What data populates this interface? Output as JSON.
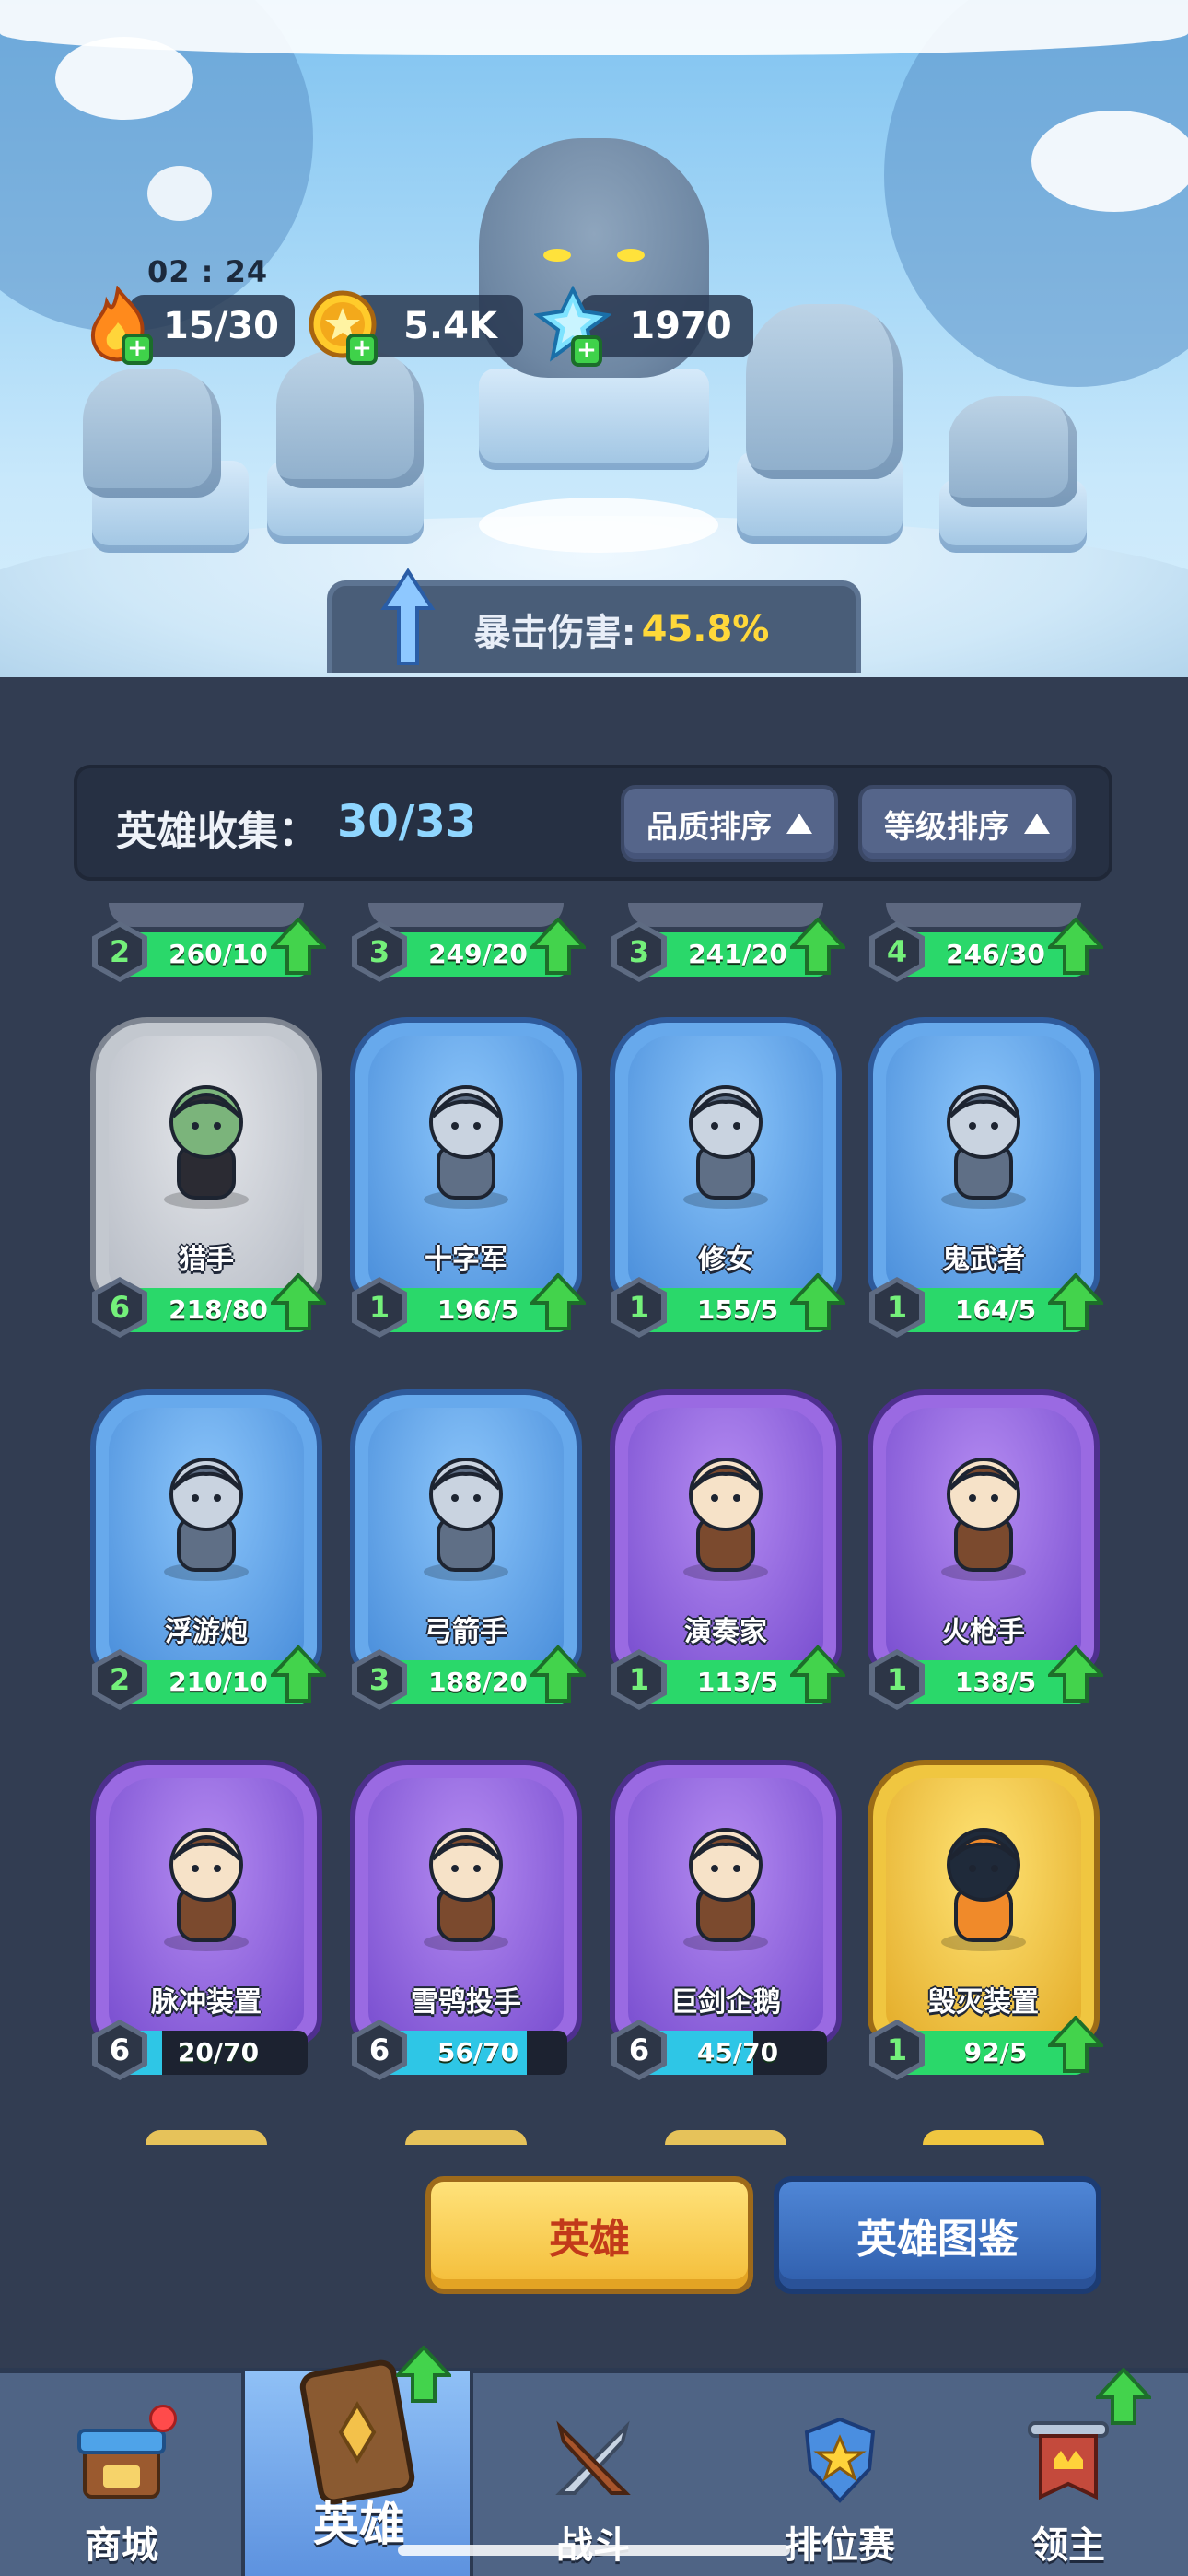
{
  "status": {
    "timer": "02 : 24",
    "energy": "15/30",
    "gold": "5.4K",
    "gems": "1970"
  },
  "crit": {
    "label": "暴击伤害:",
    "value": "45.8%"
  },
  "collection": {
    "title": "英雄收集：",
    "count": "30/33",
    "sort_quality": "品质排序",
    "sort_level": "等级排序"
  },
  "partial_row": [
    {
      "level": "2",
      "progress": "260/10",
      "fill": 1.0
    },
    {
      "level": "3",
      "progress": "249/20",
      "fill": 1.0
    },
    {
      "level": "3",
      "progress": "241/20",
      "fill": 1.0
    },
    {
      "level": "4",
      "progress": "246/30",
      "fill": 1.0
    }
  ],
  "heroes": [
    {
      "name": "猎手",
      "rarity": "grey",
      "level": "6",
      "progress": "218/80",
      "fill": 1.0,
      "upgrade": true
    },
    {
      "name": "十字军",
      "rarity": "blue",
      "level": "1",
      "progress": "196/5",
      "fill": 1.0,
      "upgrade": true
    },
    {
      "name": "修女",
      "rarity": "blue",
      "level": "1",
      "progress": "155/5",
      "fill": 1.0,
      "upgrade": true
    },
    {
      "name": "鬼武者",
      "rarity": "blue",
      "level": "1",
      "progress": "164/5",
      "fill": 1.0,
      "upgrade": true
    },
    {
      "name": "浮游炮",
      "rarity": "blue",
      "level": "2",
      "progress": "210/10",
      "fill": 1.0,
      "upgrade": true
    },
    {
      "name": "弓箭手",
      "rarity": "blue",
      "level": "3",
      "progress": "188/20",
      "fill": 1.0,
      "upgrade": true
    },
    {
      "name": "演奏家",
      "rarity": "purple",
      "level": "1",
      "progress": "113/5",
      "fill": 1.0,
      "upgrade": true
    },
    {
      "name": "火枪手",
      "rarity": "purple",
      "level": "1",
      "progress": "138/5",
      "fill": 1.0,
      "upgrade": true
    },
    {
      "name": "脉冲装置",
      "rarity": "purple",
      "level": "6",
      "progress": "20/70",
      "fill": 0.29,
      "upgrade": false
    },
    {
      "name": "雪鸮投手",
      "rarity": "purple",
      "level": "6",
      "progress": "56/70",
      "fill": 0.8,
      "upgrade": false
    },
    {
      "name": "巨剑企鹅",
      "rarity": "purple",
      "level": "6",
      "progress": "45/70",
      "fill": 0.64,
      "upgrade": false
    },
    {
      "name": "毁灭装置",
      "rarity": "gold",
      "level": "1",
      "progress": "92/5",
      "fill": 1.0,
      "upgrade": true
    }
  ],
  "actions": {
    "hero": "英雄",
    "dex": "英雄图鉴"
  },
  "nav": [
    {
      "label": "商城",
      "icon": "shop-icon"
    },
    {
      "label": "英雄",
      "icon": "hero-card-icon"
    },
    {
      "label": "战斗",
      "icon": "battle-icon"
    },
    {
      "label": "排位赛",
      "icon": "ranked-icon"
    },
    {
      "label": "领主",
      "icon": "lord-icon"
    }
  ],
  "colors": {
    "accent_gold": "#ffd83a",
    "progress_green": "#2ad86a",
    "progress_cyan": "#2ec6e6",
    "level_green": "#74f07a"
  }
}
